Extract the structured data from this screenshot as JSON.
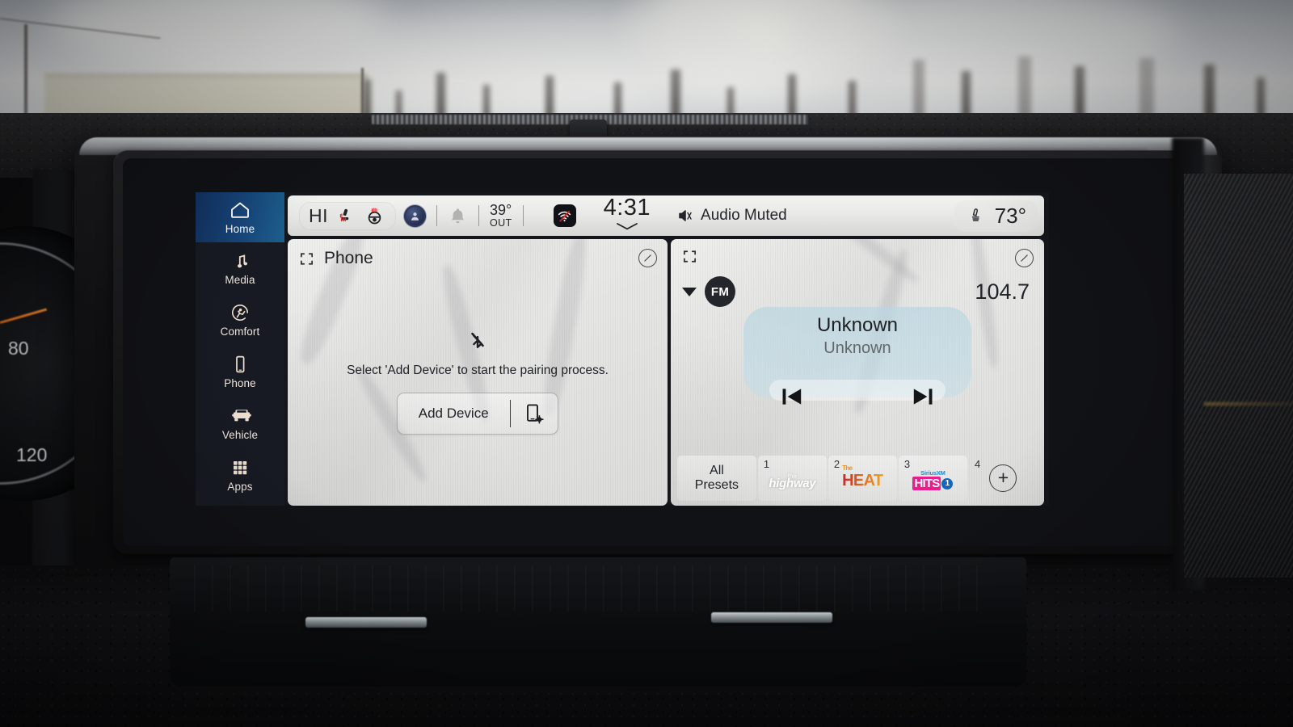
{
  "screen": {
    "sidebar": {
      "items": [
        {
          "label": "Home",
          "icon": "home-icon",
          "active": true
        },
        {
          "label": "Media",
          "icon": "music-note-icon",
          "active": false
        },
        {
          "label": "Comfort",
          "icon": "comfort-icon",
          "active": false
        },
        {
          "label": "Phone",
          "icon": "phone-device-icon",
          "active": false
        },
        {
          "label": "Vehicle",
          "icon": "vehicle-icon",
          "active": false
        },
        {
          "label": "Apps",
          "icon": "apps-grid-icon",
          "active": false
        }
      ]
    },
    "status_bar": {
      "climate_pill_label": "HI",
      "heated_seat_icon": "heated-seat-icon",
      "heated_wheel_icon": "heated-steering-wheel-icon",
      "profile_icon": "user-profile-icon",
      "notification_icon": "bell-icon",
      "outside_temp": "39°",
      "outside_temp_label": "OUT",
      "connectivity_icon": "wifi-off-icon",
      "clock": "4:31",
      "clock_expand_icon": "chevron-down-icon",
      "audio_status_icon": "audio-muted-icon",
      "audio_status": "Audio Muted",
      "seat_icon": "heated-seat-icon",
      "cabin_temp": "73°"
    },
    "phone_card": {
      "expand_icon": "expand-icon",
      "title": "Phone",
      "edit_icon": "edit-pencil-icon",
      "bluetooth_icon": "bluetooth-disabled-icon",
      "message": "Select 'Add Device' to start the pairing process.",
      "add_device_label": "Add Device",
      "add_device_icon": "phone-settings-icon"
    },
    "radio_card": {
      "expand_icon": "expand-icon",
      "edit_icon": "edit-pencil-icon",
      "source_caret_icon": "caret-down-icon",
      "band": "FM",
      "frequency": "104.7",
      "now_playing_title": "Unknown",
      "now_playing_subtitle": "Unknown",
      "prev_icon": "skip-previous-icon",
      "next_icon": "skip-next-icon",
      "presets": {
        "all_presets_line1": "All",
        "all_presets_line2": "Presets",
        "items": [
          {
            "num": "1",
            "station": "the highway",
            "logo": "highway-logo"
          },
          {
            "num": "2",
            "station": "The HEAT",
            "logo": "heat-logo"
          },
          {
            "num": "3",
            "station": "SiriusXM Hits 1",
            "logo": "hits1-logo"
          },
          {
            "num": "4",
            "station": "",
            "logo": "add-preset-icon"
          }
        ],
        "add_label": "+"
      }
    },
    "page_dots": {
      "count": 1,
      "active": 0,
      "add_page_label": "+"
    }
  },
  "colors": {
    "accent_blue": "#17477c",
    "sidebar_bg": "#171a22",
    "card_bg": "#e9e9e8",
    "now_playing_bg": "#bad6e2",
    "wifi_off_red": "#e02020",
    "heat_logo": "#e2681e",
    "hits_pink": "#ea1d8c",
    "hits_blue": "#1566c0"
  }
}
